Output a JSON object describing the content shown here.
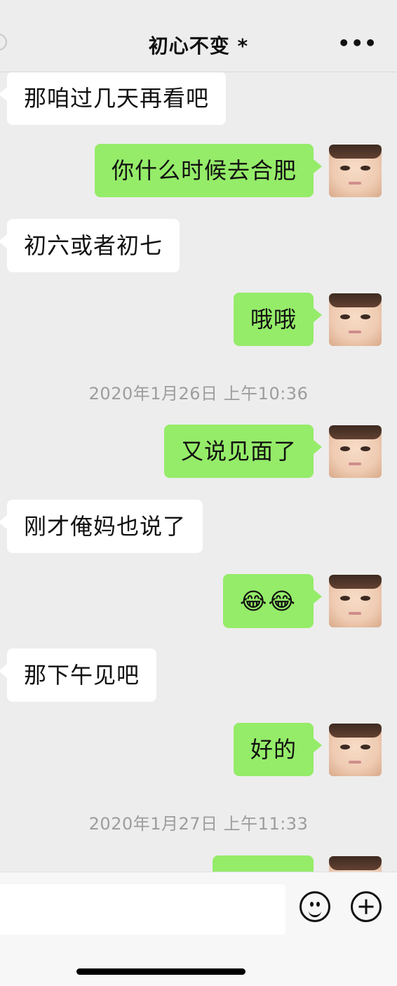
{
  "header": {
    "title": "初心不变 *",
    "more_label": "•••"
  },
  "messages": [
    {
      "side": "left",
      "text": "那咱过几天再看吧"
    },
    {
      "side": "right",
      "text": "你什么时候去合肥"
    },
    {
      "side": "left",
      "text": "初六或者初七"
    },
    {
      "side": "right",
      "text": "哦哦"
    },
    {
      "type": "time",
      "text": "2020年1月26日 上午10:36"
    },
    {
      "side": "right",
      "text": "又说见面了"
    },
    {
      "side": "left",
      "text": "刚才俺妈也说了"
    },
    {
      "side": "right",
      "text": "😂😂"
    },
    {
      "side": "left",
      "text": "那下午见吧"
    },
    {
      "side": "right",
      "text": "好的"
    },
    {
      "type": "time",
      "text": "2020年1月27日 上午11:33"
    }
  ],
  "composer": {
    "input_value": ""
  },
  "icons": {
    "emoji": "smile-icon",
    "add": "plus-circle-icon",
    "avatar": "baby-face-avatar-icon"
  }
}
